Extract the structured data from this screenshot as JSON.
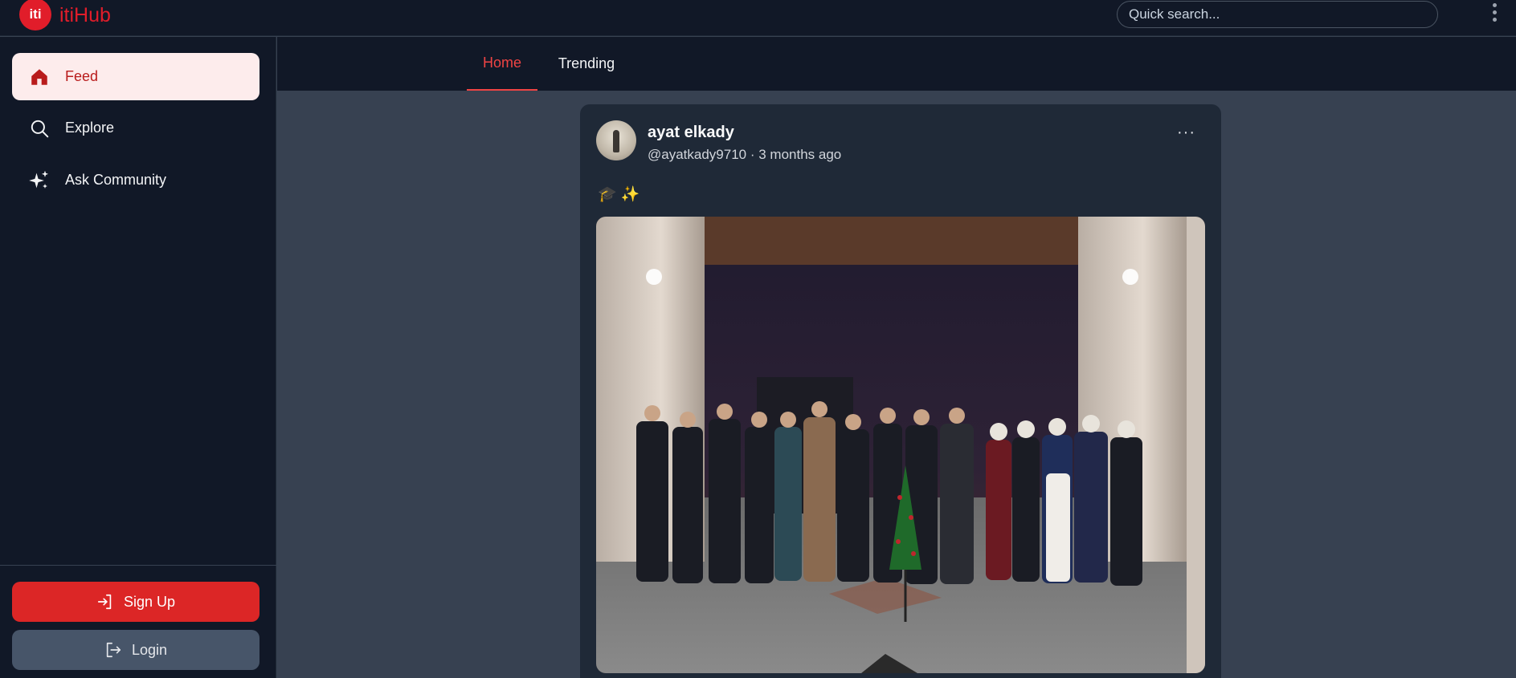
{
  "app": {
    "logo_badge": "iti",
    "name": "itiHub"
  },
  "search": {
    "placeholder": "Quick search..."
  },
  "sidebar": {
    "items": [
      {
        "label": "Feed",
        "icon": "home-icon",
        "active": true
      },
      {
        "label": "Explore",
        "icon": "search-icon",
        "active": false
      },
      {
        "label": "Ask Community",
        "icon": "sparkles-icon",
        "active": false
      }
    ],
    "signup_label": "Sign Up",
    "login_label": "Login"
  },
  "tabs": [
    {
      "label": "Home",
      "active": true
    },
    {
      "label": "Trending",
      "active": false
    }
  ],
  "post": {
    "author": "ayat elkady",
    "handle_time": "@ayatkady9710 · 3 months ago",
    "text": "🎓 ✨",
    "more_label": "···"
  },
  "colors": {
    "accent": "#dc2626",
    "background": "#374151",
    "panel": "#111827",
    "card": "#1f2937"
  }
}
